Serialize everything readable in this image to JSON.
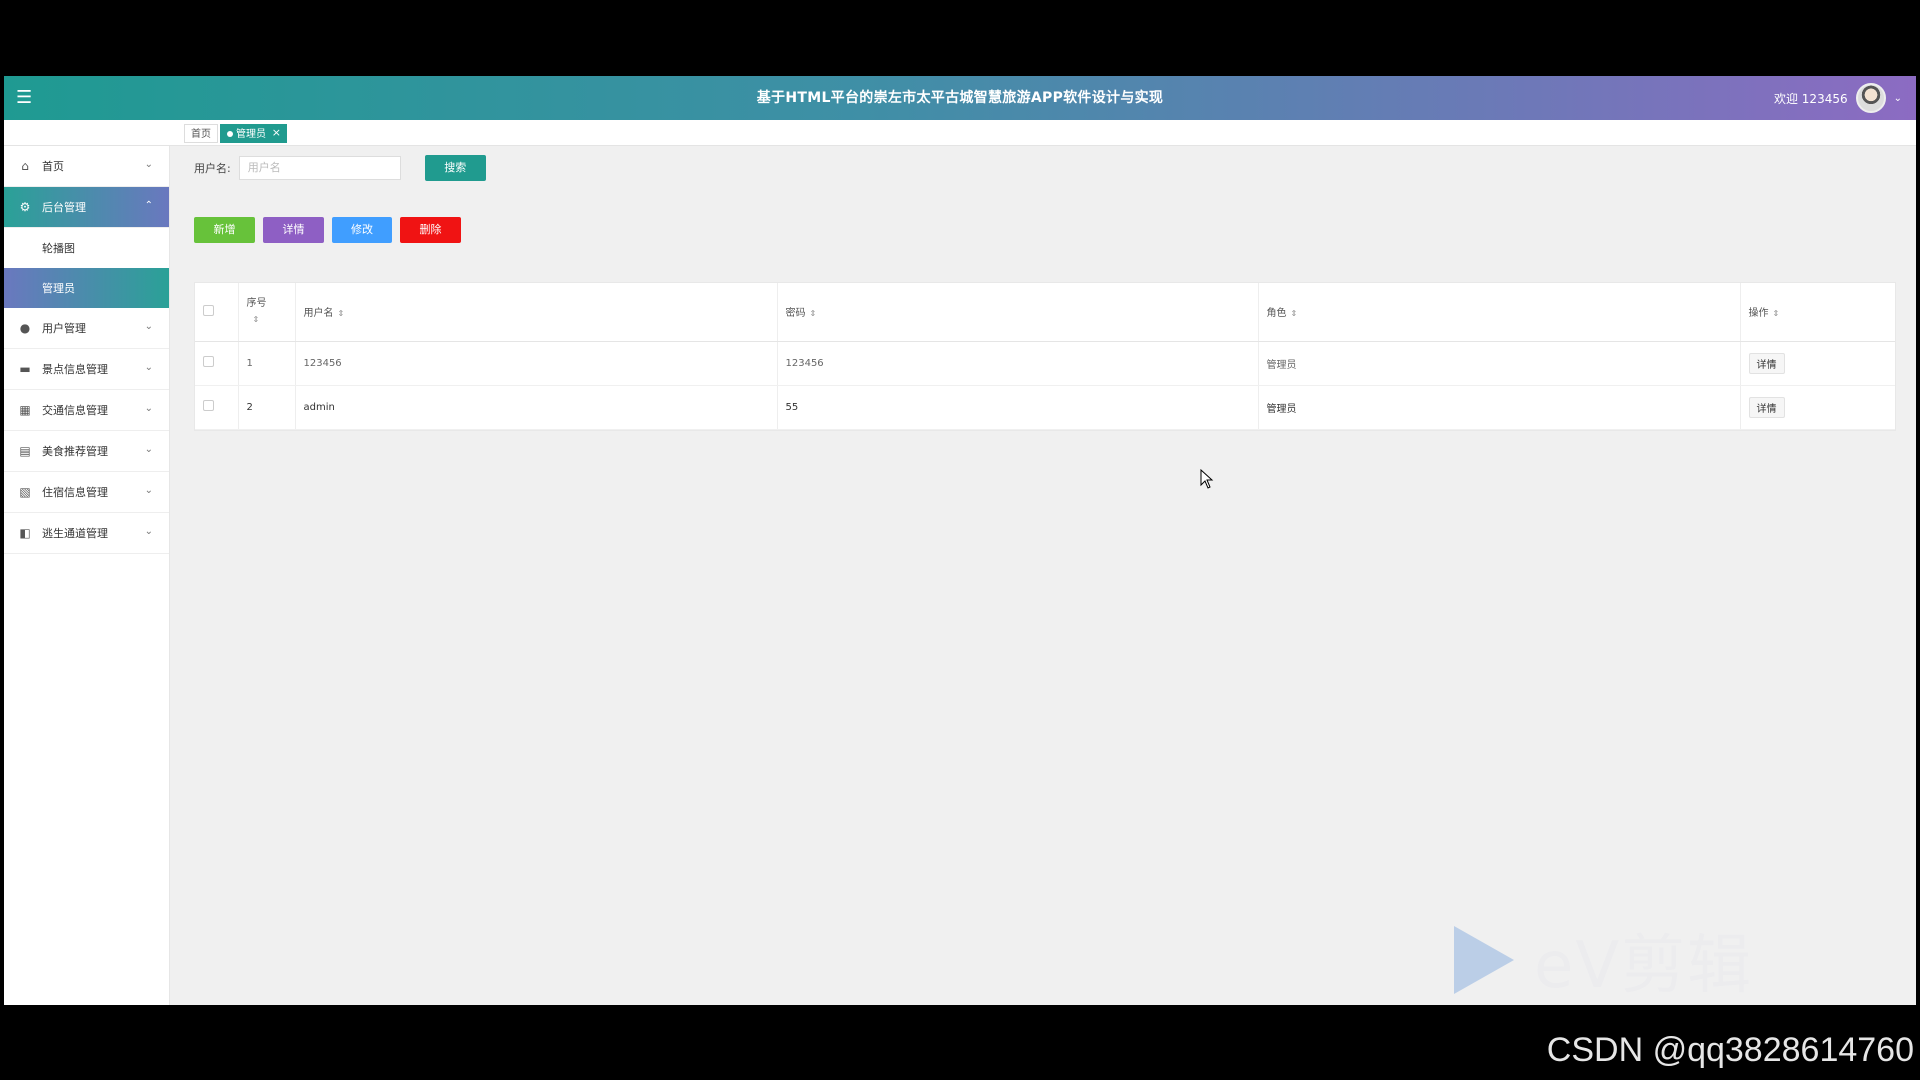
{
  "header": {
    "menu_icon": "hamburger-icon",
    "title": "基于HTML平台的崇左市太平古城智慧旅游APP软件设计与实现",
    "welcome": "欢迎 123456"
  },
  "tabs": {
    "home_label": "首页",
    "active_label": "管理员",
    "close": "×"
  },
  "sidebar": {
    "items": [
      {
        "label": "首页",
        "icon": "home-icon"
      },
      {
        "label": "后台管理",
        "icon": "gear-icon",
        "open": true,
        "children": [
          {
            "label": "轮播图"
          },
          {
            "label": "管理员",
            "active": true
          }
        ]
      },
      {
        "label": "用户管理",
        "icon": "user-icon"
      },
      {
        "label": "景点信息管理",
        "icon": "ticket-icon"
      },
      {
        "label": "交通信息管理",
        "icon": "grid-icon"
      },
      {
        "label": "美食推荐管理",
        "icon": "food-icon"
      },
      {
        "label": "住宿信息管理",
        "icon": "bed-icon"
      },
      {
        "label": "逃生通道管理",
        "icon": "exit-icon"
      }
    ]
  },
  "search": {
    "label": "用户名:",
    "placeholder": "用户名",
    "button": "搜索"
  },
  "actions": {
    "add": "新增",
    "detail": "详情",
    "edit": "修改",
    "delete": "删除"
  },
  "table": {
    "headers": [
      "序号",
      "用户名",
      "密码",
      "角色",
      "操作"
    ],
    "rows": [
      {
        "index": "1",
        "username": "123456",
        "password": "123456",
        "role": "管理员",
        "action": "详情"
      },
      {
        "index": "2",
        "username": "admin",
        "password": "55",
        "role": "管理员",
        "action": "详情"
      }
    ]
  },
  "overlay": {
    "watermark": "eV剪辑",
    "credit": "CSDN @qq3828614760"
  }
}
